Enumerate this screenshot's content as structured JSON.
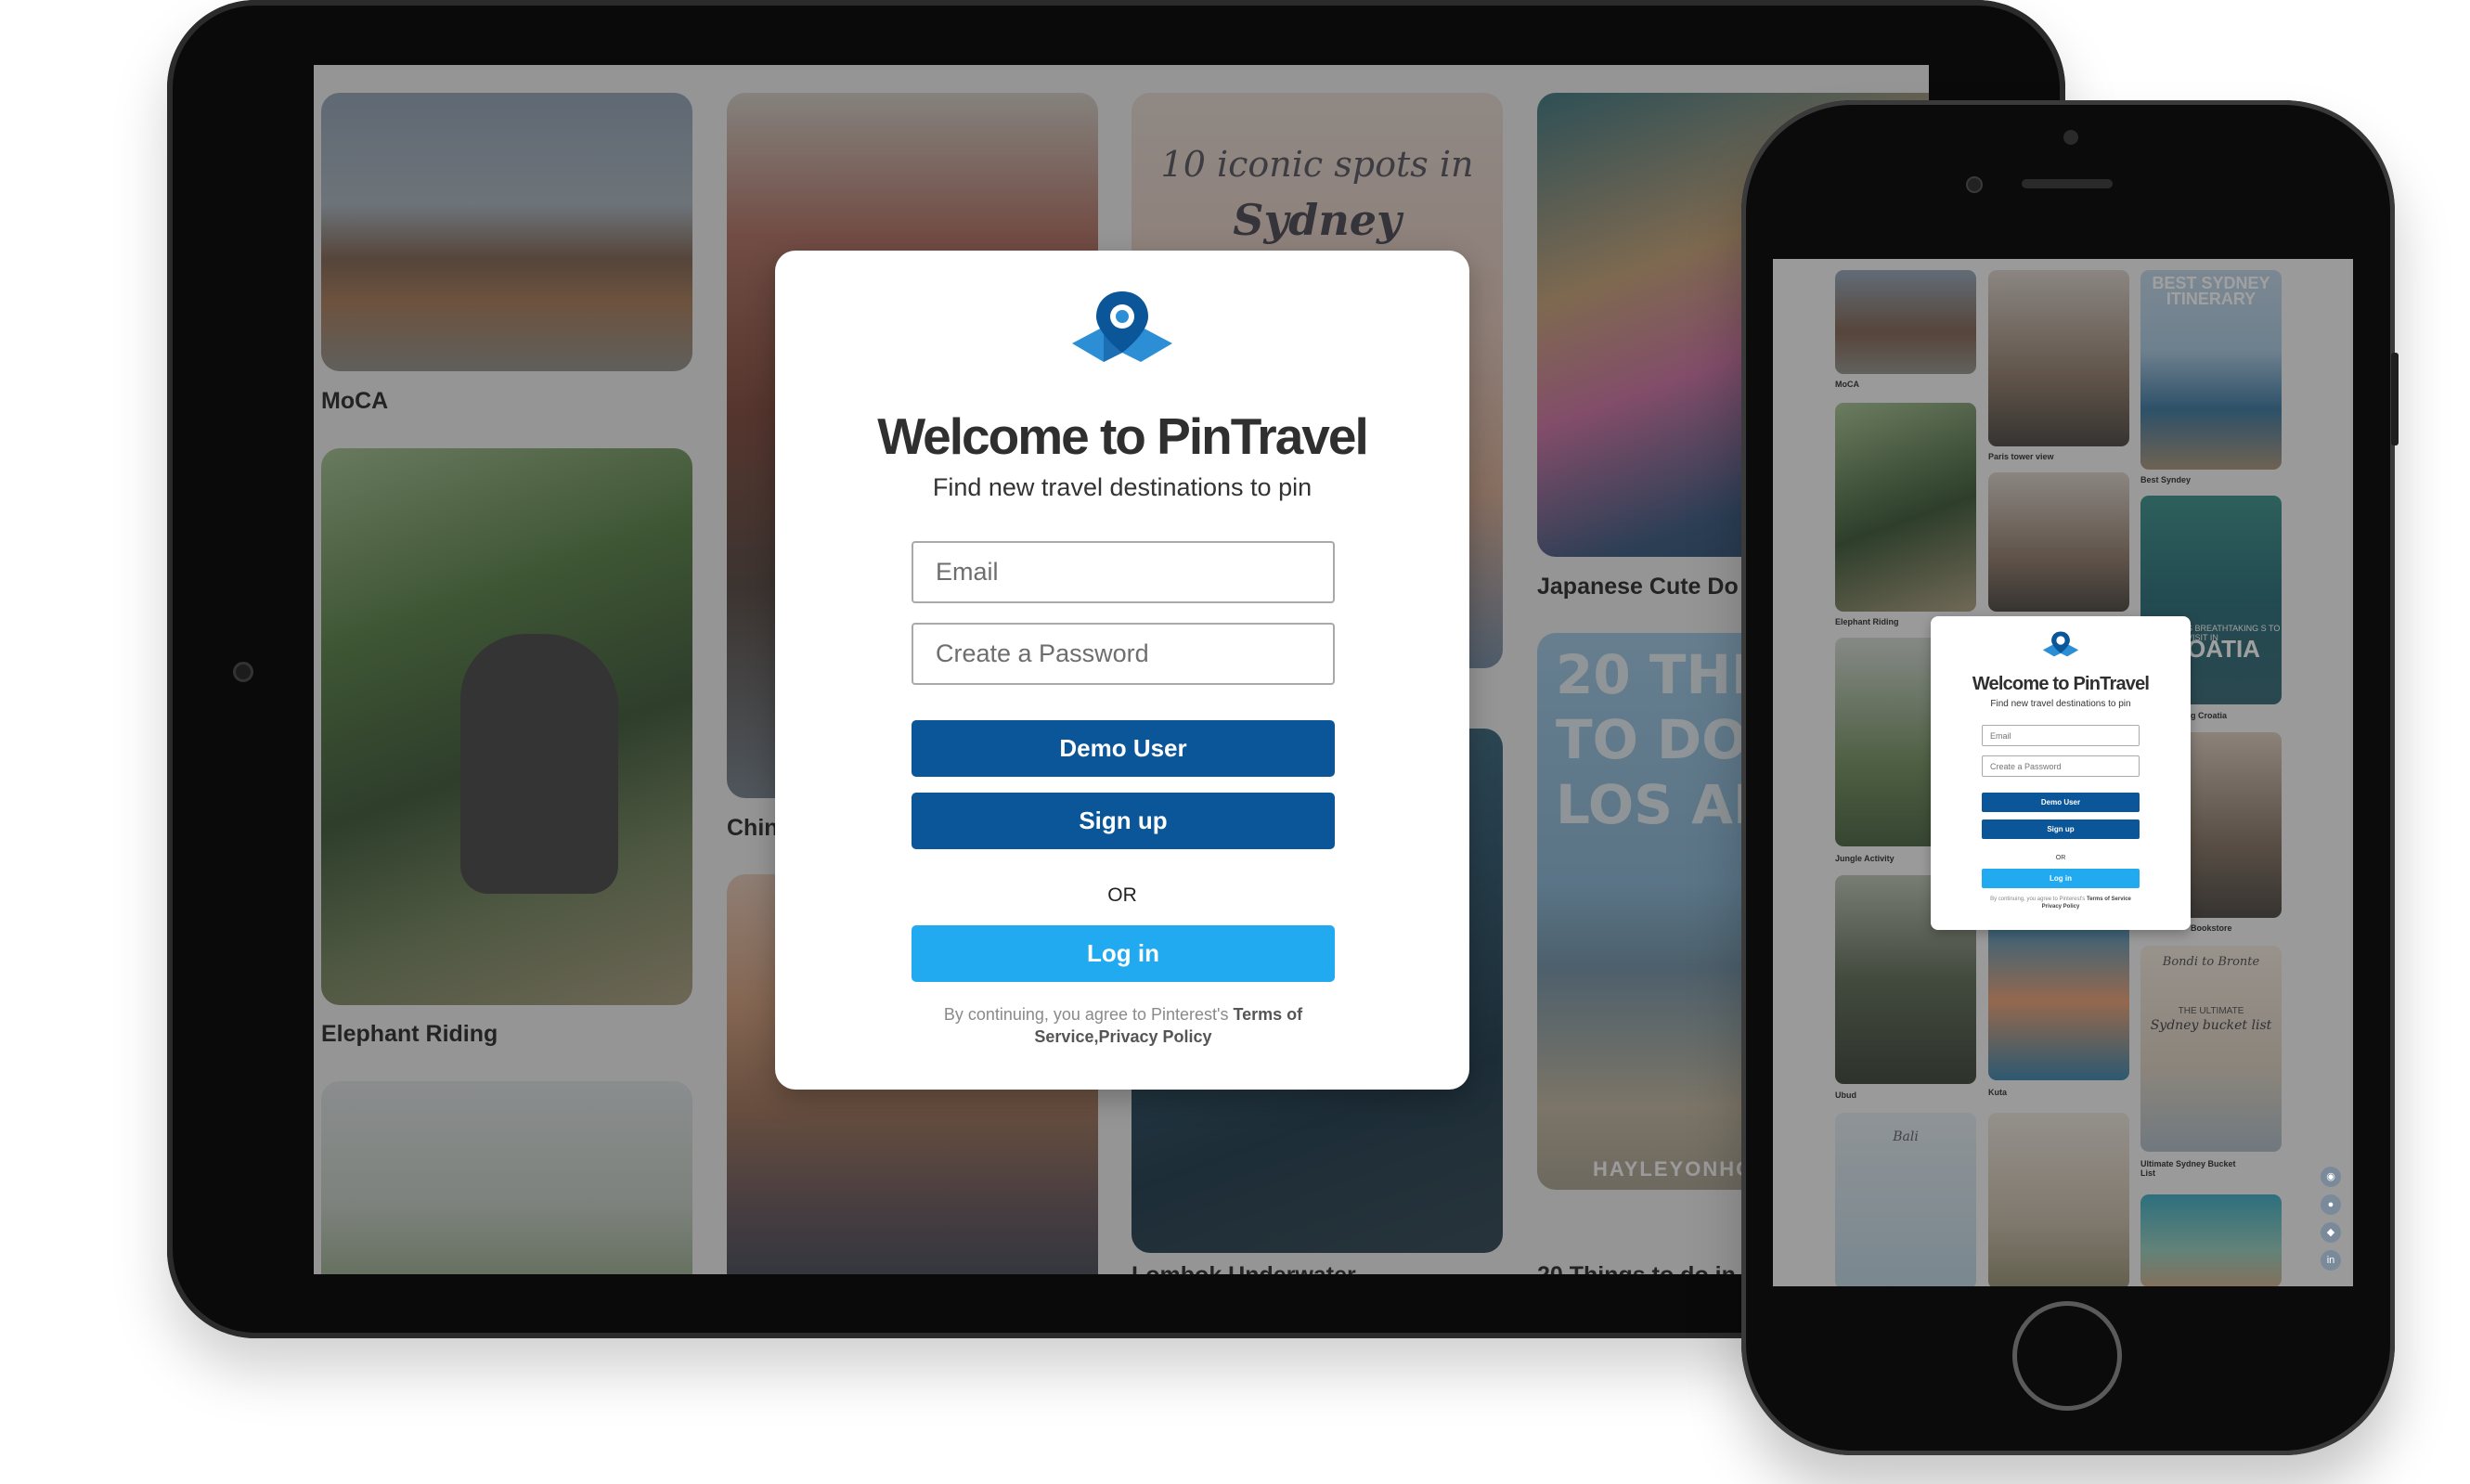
{
  "app": {
    "brand_color": "#0b5698",
    "login_color": "#22aaf0"
  },
  "tablet": {
    "pins": [
      {
        "label": "MoCA"
      },
      {
        "label": "Elephant Riding"
      },
      {
        "label": "Chin"
      },
      {
        "label": "10 iconic spots in"
      },
      {
        "label": "Sydney Australia"
      },
      {
        "label": "Lombok Underwater"
      },
      {
        "label": "Japanese Cute Do"
      },
      {
        "label": "20 THI"
      },
      {
        "label": "TO DO"
      },
      {
        "label": "LOS AN"
      },
      {
        "label": "HAYLEYONHOLI"
      },
      {
        "label": "20 Things to do in"
      }
    ],
    "modal": {
      "logo_icon": "map-pin-icon",
      "title": "Welcome to PinTravel",
      "subtitle": "Find new travel destinations to pin",
      "email_placeholder": "Email",
      "password_placeholder": "Create a Password",
      "demo_label": "Demo User",
      "signup_label": "Sign up",
      "or_label": "OR",
      "login_label": "Log in",
      "terms_prefix": "By continuing, you agree to Pinterest's",
      "terms_link": "Terms of Service",
      "terms_sep": ",",
      "privacy_link": "Privacy Policy"
    }
  },
  "phone": {
    "pins": [
      {
        "label": "MoCA"
      },
      {
        "label": "Paris tower view"
      },
      {
        "label": "BEST SYDNEY ITINERARY"
      },
      {
        "label": "Best Syndey"
      },
      {
        "label": "Elephant Riding"
      },
      {
        "label": "S BREATHTAKING S TO VISIT IN"
      },
      {
        "label": "OATIA"
      },
      {
        "label": "g Croatia"
      },
      {
        "label": "Jungle Activity"
      },
      {
        "label": "Bookstore"
      },
      {
        "label": "Ubud"
      },
      {
        "label": "Kuta"
      },
      {
        "label": "Bondi to Bronte"
      },
      {
        "label": "THE ULTIMATE"
      },
      {
        "label": "Sydney bucket list"
      },
      {
        "label": "Ultimate Sydney Bucket List"
      },
      {
        "label": "Bali"
      }
    ],
    "modal": {
      "title": "Welcome to PinTravel",
      "subtitle": "Find new travel destinations to pin",
      "email_placeholder": "Email",
      "password_placeholder": "Create a Password",
      "demo_label": "Demo User",
      "signup_label": "Sign up",
      "or_label": "OR",
      "login_label": "Log in",
      "terms_prefix": "By continuing, you agree to Pinterest's",
      "terms_link": "Terms of Service",
      "privacy_link": "Privacy Policy"
    },
    "social_icons": [
      "pintravel-icon",
      "github-icon",
      "portfolio-icon",
      "linkedin-icon"
    ]
  }
}
